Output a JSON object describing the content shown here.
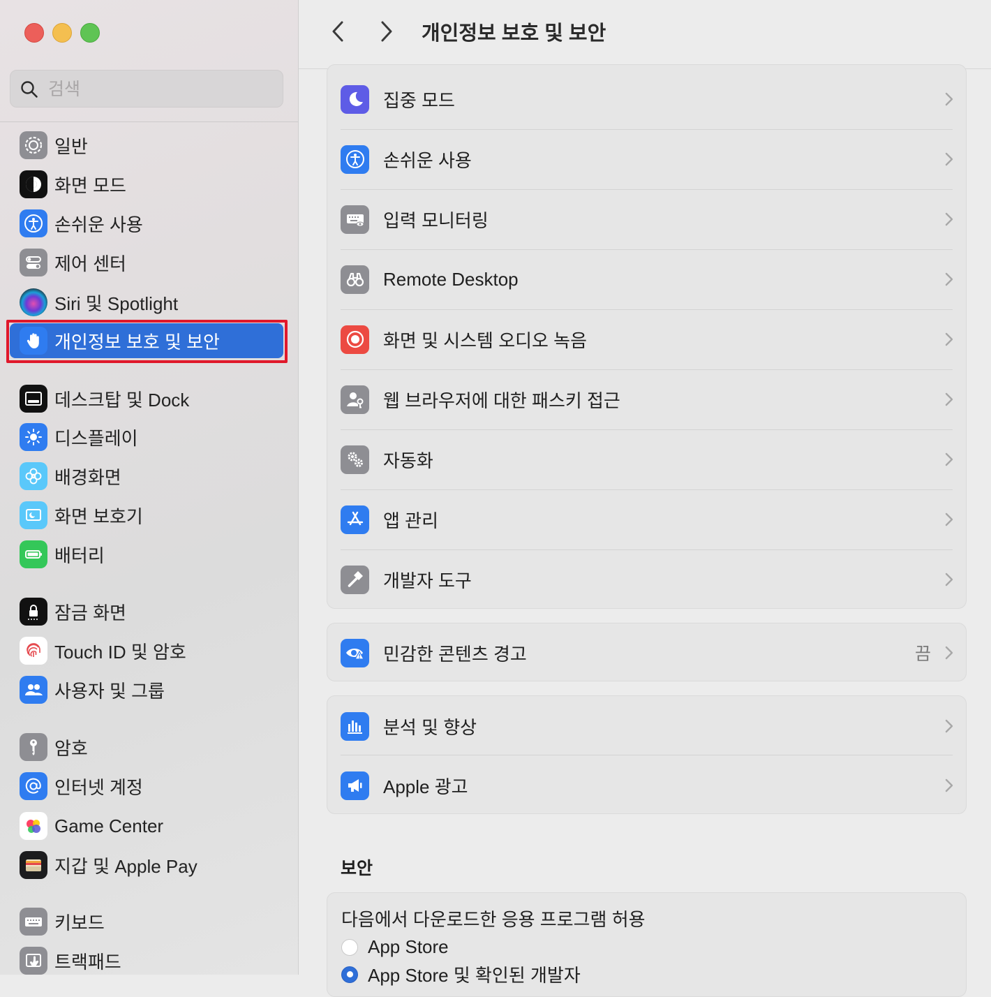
{
  "window": {
    "title": "개인정보 보호 및 보안"
  },
  "search": {
    "placeholder": "검색",
    "value": ""
  },
  "sidebar": {
    "items": [
      {
        "label": "일반",
        "icon": "gear-icon"
      },
      {
        "label": "화면 모드",
        "icon": "appearance-icon"
      },
      {
        "label": "손쉬운 사용",
        "icon": "accessibility-icon"
      },
      {
        "label": "제어 센터",
        "icon": "control-center-icon"
      },
      {
        "label": "Siri 및 Spotlight",
        "icon": "siri-icon"
      },
      {
        "label": "개인정보 보호 및 보안",
        "icon": "hand-icon",
        "selected": true
      },
      {
        "label": "데스크탑 및 Dock",
        "icon": "desktop-dock-icon"
      },
      {
        "label": "디스플레이",
        "icon": "sun-icon"
      },
      {
        "label": "배경화면",
        "icon": "flower-icon"
      },
      {
        "label": "화면 보호기",
        "icon": "screensaver-icon"
      },
      {
        "label": "배터리",
        "icon": "battery-icon"
      },
      {
        "label": "잠금 화면",
        "icon": "lock-icon"
      },
      {
        "label": "Touch ID 및 암호",
        "icon": "fingerprint-icon"
      },
      {
        "label": "사용자 및 그룹",
        "icon": "users-icon"
      },
      {
        "label": "암호",
        "icon": "key-icon"
      },
      {
        "label": "인터넷 계정",
        "icon": "at-icon"
      },
      {
        "label": "Game Center",
        "icon": "game-center-icon"
      },
      {
        "label": "지갑 및 Apple Pay",
        "icon": "wallet-icon"
      },
      {
        "label": "키보드",
        "icon": "keyboard-icon"
      },
      {
        "label": "트랙패드",
        "icon": "trackpad-icon"
      }
    ]
  },
  "main": {
    "title": "개인정보 보호 및 보안",
    "group1": [
      {
        "label": "집중 모드",
        "icon": "moon-icon"
      },
      {
        "label": "손쉬운 사용",
        "icon": "accessibility-icon"
      },
      {
        "label": "입력 모니터링",
        "icon": "keyboard-icon"
      },
      {
        "label": "Remote Desktop",
        "icon": "binoculars-icon"
      },
      {
        "label": "화면 및 시스템 오디오 녹음",
        "icon": "record-icon"
      },
      {
        "label": "웹 브라우저에 대한 패스키 접근",
        "icon": "person-key-icon"
      },
      {
        "label": "자동화",
        "icon": "gears-icon"
      },
      {
        "label": "앱 관리",
        "icon": "app-store-icon"
      },
      {
        "label": "개발자 도구",
        "icon": "hammer-icon"
      }
    ],
    "group2": [
      {
        "label": "민감한 콘텐츠 경고",
        "value": "끔",
        "icon": "eye-warning-icon"
      }
    ],
    "group3": [
      {
        "label": "분석 및 향상",
        "icon": "chart-icon"
      },
      {
        "label": "Apple 광고",
        "icon": "megaphone-icon"
      }
    ],
    "security": {
      "title": "보안",
      "allow_label": "다음에서 다운로드한 응용 프로그램 허용",
      "options": [
        {
          "label": "App Store",
          "selected": false
        },
        {
          "label": "App Store 및 확인된 개발자",
          "selected": true
        }
      ]
    }
  },
  "colors": {
    "accent": "#2f6fd8",
    "highlight_frame": "#e0182b"
  }
}
